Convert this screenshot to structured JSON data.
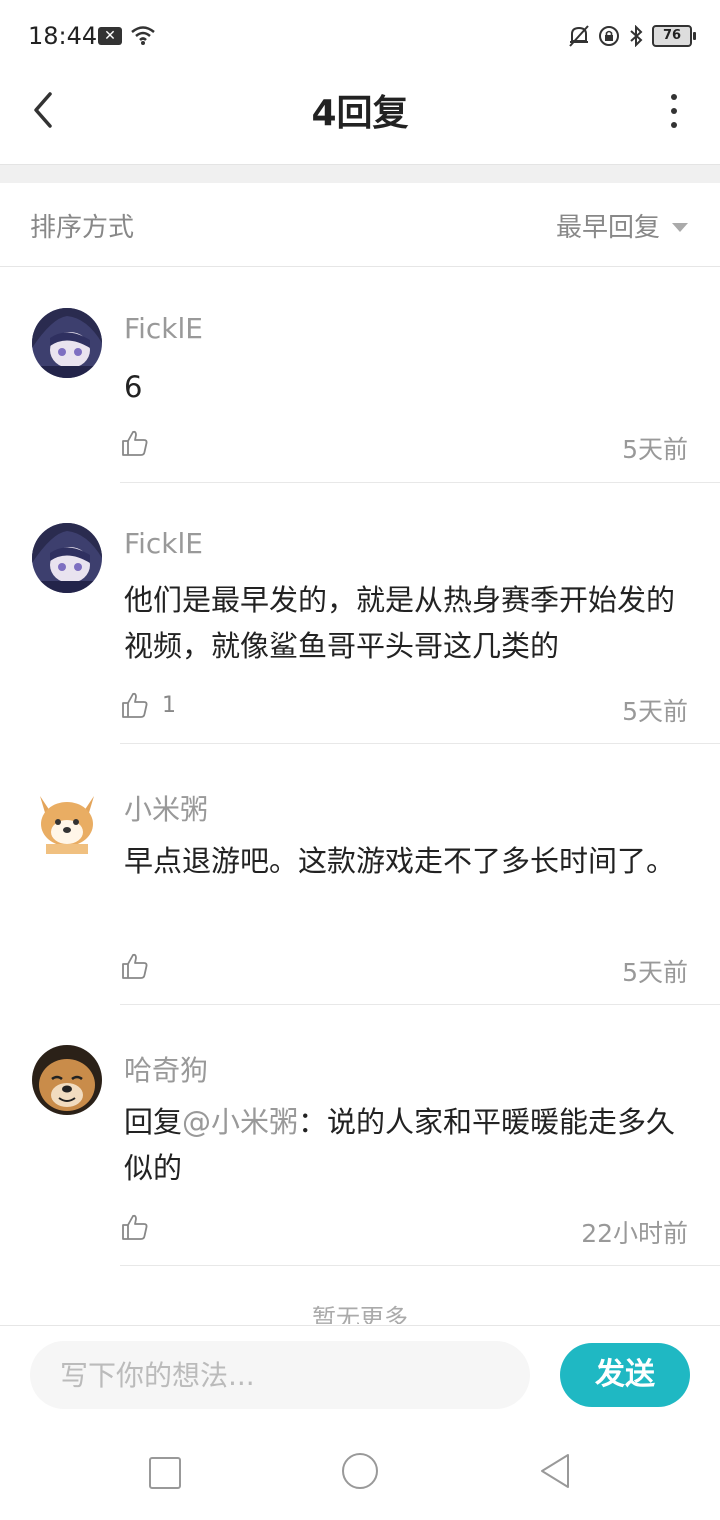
{
  "status_bar": {
    "time": "18:44",
    "battery": "76"
  },
  "header": {
    "title": "4回复"
  },
  "sort": {
    "label": "排序方式",
    "value": "最早回复"
  },
  "comments": [
    {
      "name": "FicklE",
      "text": "6",
      "likes": "",
      "time": "5天前"
    },
    {
      "name": "FicklE",
      "text": "他们是最早发的，就是从热身赛季开始发的视频，就像鲨鱼哥平头哥这几类的",
      "likes": "1",
      "time": "5天前"
    },
    {
      "name": "小米粥",
      "text": "早点退游吧。这款游戏走不了多长时间了。",
      "likes": "",
      "time": "5天前"
    },
    {
      "name": "哈奇狗",
      "reply_prefix": "回复",
      "mention": "@小米粥",
      "text": "：说的人家和平暖暖能走多久似的",
      "likes": "",
      "time": "22小时前"
    }
  ],
  "no_more": "暂无更多",
  "input": {
    "placeholder": "写下你的想法..."
  },
  "send_button": "发送",
  "colors": {
    "accent": "#1fb8c3"
  }
}
